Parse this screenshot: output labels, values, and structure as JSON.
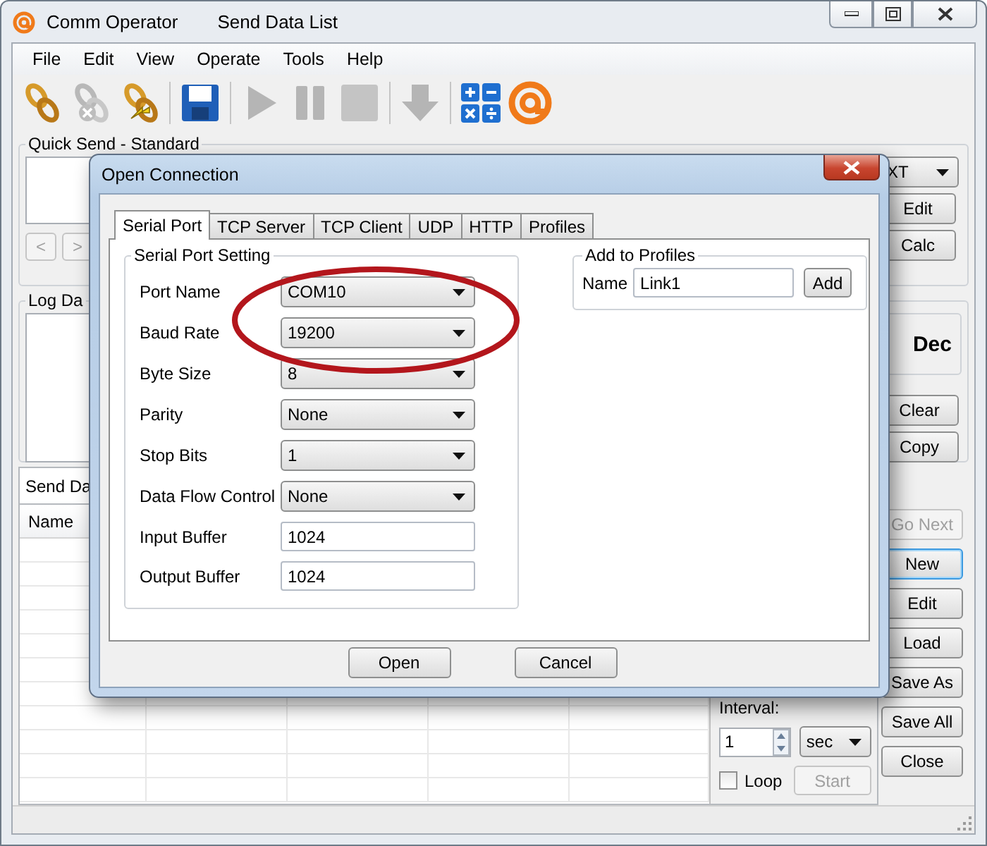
{
  "window": {
    "title": "Comm Operator",
    "subtitle": "Send Data List"
  },
  "menu": [
    "File",
    "Edit",
    "View",
    "Operate",
    "Tools",
    "Help"
  ],
  "toolbar": [
    [
      {
        "kind": "connect",
        "disabled": false
      },
      {
        "kind": "disconnect",
        "disabled": true
      },
      {
        "kind": "reconnect",
        "disabled": false
      }
    ],
    [
      {
        "kind": "save",
        "disabled": false
      }
    ],
    [
      {
        "kind": "play",
        "disabled": true
      },
      {
        "kind": "pause",
        "disabled": true
      },
      {
        "kind": "stop",
        "disabled": true
      }
    ],
    [
      {
        "kind": "download",
        "disabled": true
      }
    ],
    [
      {
        "kind": "calculator",
        "disabled": false
      },
      {
        "kind": "logo",
        "disabled": false
      }
    ]
  ],
  "quick_send": {
    "title": "Quick Send - Standard",
    "nav": [
      {
        "label": "<",
        "disabled": true
      },
      {
        "label": ">",
        "disabled": true
      }
    ],
    "format": "XT",
    "buttons": [
      "Edit",
      "Calc"
    ]
  },
  "log": {
    "title": "Log Da",
    "mode": "Dec",
    "buttons": [
      "Clear",
      "Copy"
    ]
  },
  "send_data": {
    "tab": "Send Da",
    "columns": [
      "Name"
    ],
    "interval_label": "Interval:",
    "interval": "1",
    "unit": "sec",
    "loop": {
      "label": "Loop",
      "checked": false
    },
    "start": {
      "label": "Start",
      "disabled": true
    },
    "buttons": [
      {
        "label": "Go Next",
        "disabled": true,
        "focused": false
      },
      {
        "label": "New",
        "disabled": false,
        "focused": true
      },
      {
        "label": "Edit",
        "disabled": false,
        "focused": false
      },
      {
        "label": "Load",
        "disabled": false,
        "focused": false
      },
      {
        "label": "Save As",
        "disabled": false,
        "focused": false
      },
      {
        "label": "Save All",
        "disabled": false,
        "focused": false
      },
      {
        "label": "Close",
        "disabled": false,
        "focused": false
      }
    ]
  },
  "dialog": {
    "title": "Open Connection",
    "tabs": [
      {
        "label": "Serial Port",
        "selected": true
      },
      {
        "label": "TCP Server",
        "selected": false
      },
      {
        "label": "TCP Client",
        "selected": false
      },
      {
        "label": "UDP",
        "selected": false
      },
      {
        "label": "HTTP",
        "selected": false
      },
      {
        "label": "Profiles",
        "selected": false
      }
    ],
    "group": "Serial Port Setting",
    "fields": [
      {
        "label": "Port Name",
        "kind": "select",
        "value": "COM10"
      },
      {
        "label": "Baud Rate",
        "kind": "select",
        "value": "19200"
      },
      {
        "label": "Byte Size",
        "kind": "select",
        "value": "8"
      },
      {
        "label": "Parity",
        "kind": "select",
        "value": "None"
      },
      {
        "label": "Stop Bits",
        "kind": "select",
        "value": "1"
      },
      {
        "label": "Data Flow Control",
        "kind": "select",
        "value": "None"
      },
      {
        "label": "Input Buffer",
        "kind": "text",
        "value": "1024"
      },
      {
        "label": "Output Buffer",
        "kind": "text",
        "value": "1024"
      }
    ],
    "profiles": {
      "title": "Add to Profiles",
      "name_label": "Name",
      "name": "Link1",
      "button": "Add"
    },
    "buttons": [
      "Open",
      "Cancel"
    ]
  }
}
